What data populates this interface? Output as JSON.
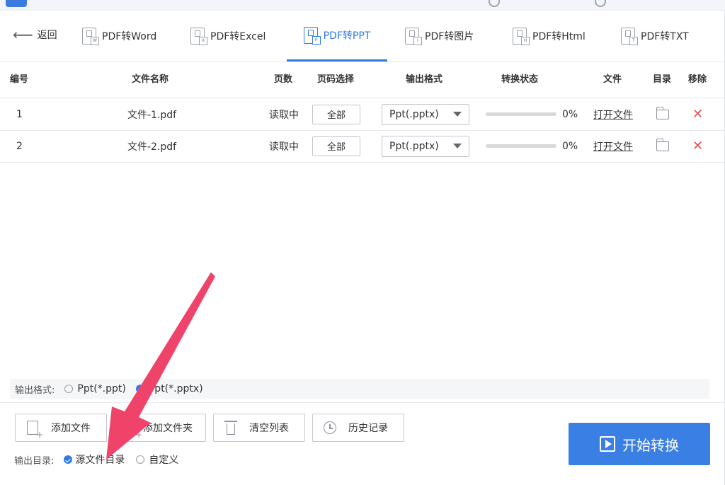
{
  "back": {
    "label": "返回"
  },
  "tabs": [
    {
      "label": "PDF转Word",
      "sub": "W",
      "active": false
    },
    {
      "label": "PDF转Excel",
      "sub": "X",
      "active": false
    },
    {
      "label": "PDF转PPT",
      "sub": "P",
      "active": true
    },
    {
      "label": "PDF转图片",
      "sub": "I",
      "active": false
    },
    {
      "label": "PDF转Html",
      "sub": "H",
      "active": false
    },
    {
      "label": "PDF转TXT",
      "sub": "T",
      "active": false
    }
  ],
  "table": {
    "headers": {
      "index": "编号",
      "name": "文件名称",
      "pages": "页数",
      "range": "页码选择",
      "format": "输出格式",
      "status": "转换状态",
      "file": "文件",
      "dir": "目录",
      "remove": "移除"
    },
    "rows": [
      {
        "index": "1",
        "name": "文件-1.pdf",
        "pages": "读取中",
        "range": "全部",
        "format": "Ppt(.pptx)",
        "progress": 0,
        "percent": "0%",
        "open": "打开文件"
      },
      {
        "index": "2",
        "name": "文件-2.pdf",
        "pages": "读取中",
        "range": "全部",
        "format": "Ppt(.pptx)",
        "progress": 0,
        "percent": "0%",
        "open": "打开文件"
      }
    ]
  },
  "output_format": {
    "label": "输出格式:",
    "options": [
      {
        "label": "Ppt(*.ppt)",
        "selected": false
      },
      {
        "label": "Ppt(*.pptx)",
        "selected": true
      }
    ]
  },
  "toolbar": {
    "add_file": "添加文件",
    "add_folder": "添加文件夹",
    "clear_list": "清空列表",
    "history": "历史记录"
  },
  "output_dir": {
    "label": "输出目录:",
    "options": [
      {
        "label": "源文件目录",
        "selected": true
      },
      {
        "label": "自定义",
        "selected": false
      }
    ]
  },
  "start": {
    "label": "开始转换"
  },
  "colors": {
    "accent": "#2f7be6",
    "annotation_arrow": "#f0436a",
    "remove": "#e34d4d"
  }
}
